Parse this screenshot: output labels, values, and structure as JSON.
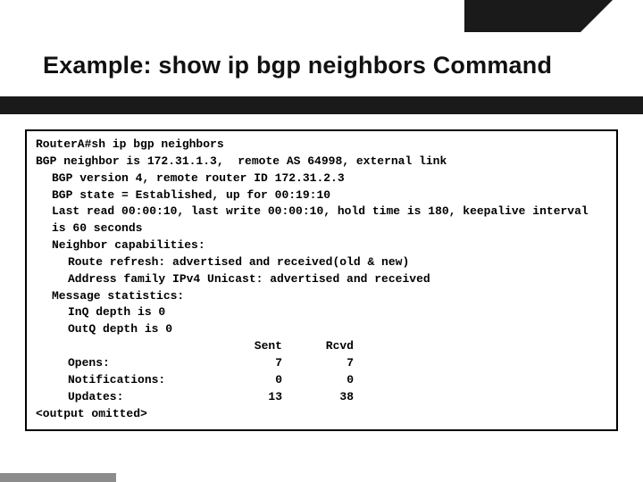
{
  "slide": {
    "title": "Example: show ip bgp neighbors Command"
  },
  "terminal": {
    "command": "RouterA#sh ip bgp neighbors",
    "lines": {
      "summary": "BGP neighbor is 172.31.1.3,  remote AS 64998, external link",
      "version": "BGP version 4, remote router ID 172.31.2.3",
      "state": "BGP state = Established, up for 00:19:10",
      "last_read": "Last read 00:00:10, last write 00:00:10, hold time is 180, keepalive interval is 60 seconds",
      "capabilities_header": "Neighbor capabilities:",
      "cap_route_refresh": "Route refresh: advertised and received(old & new)",
      "cap_afi": "Address family IPv4 Unicast: advertised and received",
      "msg_stats_header": "Message statistics:",
      "inq": "InQ depth is 0",
      "outq": "OutQ depth is 0"
    },
    "stats": {
      "header_sent": "Sent",
      "header_rcvd": "Rcvd",
      "rows": {
        "opens": {
          "label": "Opens:",
          "sent": "7",
          "rcvd": "7"
        },
        "notifications": {
          "label": "Notifications:",
          "sent": "0",
          "rcvd": "0"
        },
        "updates": {
          "label": "Updates:",
          "sent": "13",
          "rcvd": "38"
        }
      }
    },
    "omitted": "<output omitted>"
  }
}
